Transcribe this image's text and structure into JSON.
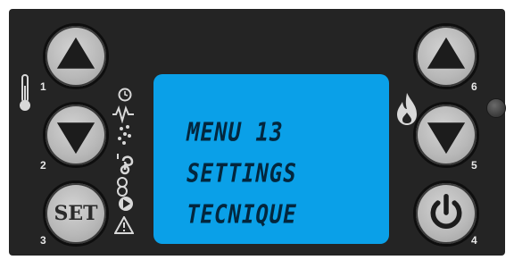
{
  "display": {
    "line1": "MENU 13",
    "line2": "SETTINGS",
    "line3": "TECNIQUE"
  },
  "buttons": {
    "up_left_number": "1",
    "down_left_number": "2",
    "set_number": "3",
    "set_label": "SET",
    "power_number": "4",
    "down_right_number": "5",
    "up_right_number": "6"
  },
  "icons": {
    "left_side": [
      "thermometer-icon",
      "clock-icon",
      "heating-element-icon",
      "pellets-icon",
      "fan-icon",
      "pump-icon",
      "warning-icon"
    ],
    "right_side": [
      "flame-icon",
      "status-led"
    ]
  },
  "colors": {
    "panel": "#242424",
    "display": "#0aa0e8",
    "display_text": "#03263d",
    "button": "#bdbdbd"
  }
}
